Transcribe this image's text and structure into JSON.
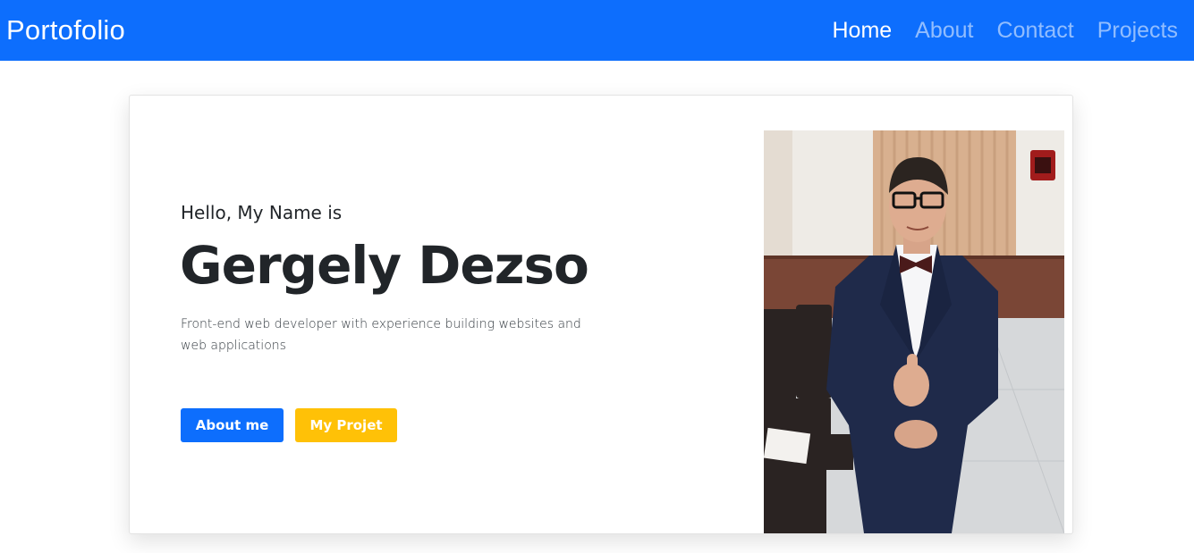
{
  "navbar": {
    "brand": "Portofolio",
    "links": [
      {
        "label": "Home",
        "active": true
      },
      {
        "label": "About",
        "active": false
      },
      {
        "label": "Contact",
        "active": false
      },
      {
        "label": "Projects",
        "active": false
      }
    ]
  },
  "hero": {
    "greeting": "Hello, My Name is",
    "name": "Gergely Dezso",
    "description": "Front-end web developer with experience building websites and web applications",
    "buttons": {
      "about_label": "About me",
      "projects_label": "My Projet"
    }
  },
  "colors": {
    "primary": "#0d6efd",
    "warning": "#ffc107",
    "text": "#212529"
  }
}
